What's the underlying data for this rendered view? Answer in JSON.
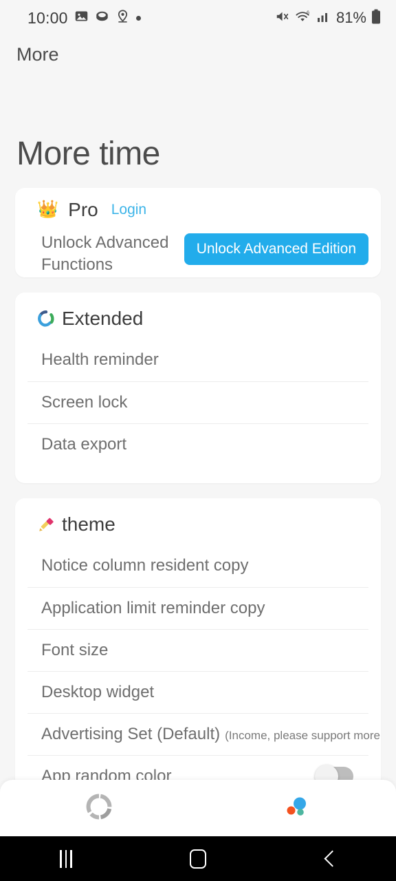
{
  "status_bar": {
    "time": "10:00",
    "left_icons": [
      "image-icon",
      "cookie-icon",
      "location-pin-icon",
      "dot-icon"
    ],
    "right_icons": [
      "mute-icon",
      "wifi-6-icon",
      "cellular-signal-icon",
      "battery-icon"
    ],
    "battery_percent": "81%"
  },
  "toolbar": {
    "title": "More"
  },
  "page": {
    "title": "More time"
  },
  "pro_card": {
    "icon": "crown-icon",
    "title": "Pro",
    "login_label": "Login",
    "description": "Unlock Advanced Functions",
    "button_label": "Unlock Advanced Edition",
    "button_color": "#22aceb",
    "login_color": "#3cb4e8"
  },
  "extended_section": {
    "icon": "extended-ring-icon",
    "title": "Extended",
    "rows": [
      {
        "label": "Health reminder"
      },
      {
        "label": "Screen lock"
      },
      {
        "label": "Data export"
      }
    ]
  },
  "theme_section": {
    "icon": "paintbrush-icon",
    "title": "theme",
    "rows": [
      {
        "label": "Notice column resident copy",
        "note": ""
      },
      {
        "label": "Application limit reminder copy",
        "note": ""
      },
      {
        "label": "Font size",
        "note": ""
      },
      {
        "label": "Desktop widget",
        "note": ""
      },
      {
        "label": "Advertising Set (Default)",
        "note": "(Income, please support more!)"
      },
      {
        "label": "App random color",
        "note": "",
        "toggle": "off"
      }
    ]
  },
  "bottom_nav": {
    "items": [
      {
        "icon": "segmented-ring-icon",
        "state": "inactive"
      },
      {
        "icon": "bubbles-icon",
        "state": "active"
      }
    ]
  },
  "android_nav": {
    "buttons": [
      "recents-button",
      "home-button",
      "back-button"
    ]
  },
  "colors": {
    "page_background": "#f6f6f6",
    "card_background": "#ffffff",
    "primary_text": "#3c3c3c",
    "secondary_text": "#6e6e6e",
    "accent_blue": "#22aceb"
  }
}
